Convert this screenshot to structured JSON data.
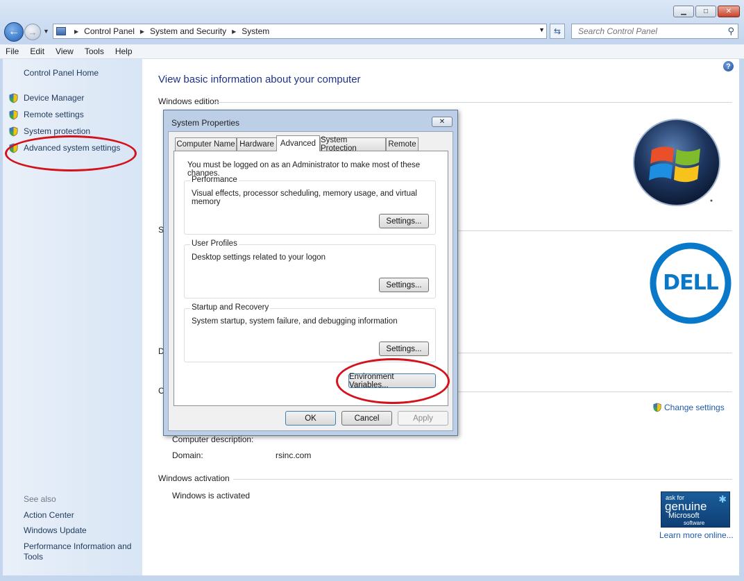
{
  "window": {
    "minimize_glyph": "▁",
    "maximize_glyph": "□",
    "close_glyph": "✕"
  },
  "address": {
    "crumbs": [
      "Control Panel",
      "System and Security",
      "System"
    ],
    "search_placeholder": "Search Control Panel"
  },
  "menu": [
    "File",
    "Edit",
    "View",
    "Tools",
    "Help"
  ],
  "sidebar": {
    "home": "Control Panel Home",
    "items": [
      "Device Manager",
      "Remote settings",
      "System protection",
      "Advanced system settings"
    ],
    "see_also_label": "See also",
    "see_also": [
      "Action Center",
      "Windows Update",
      "Performance Information and Tools"
    ]
  },
  "main": {
    "title": "View basic information about your computer",
    "windows_edition": "Windows edition",
    "partial_s": "S",
    "partial_d": "D",
    "partial_c": "C",
    "computer_description_label": "Computer description:",
    "domain_label": "Domain:",
    "domain_value": "rsinc.com",
    "change_settings": "Change settings",
    "windows_activation": "Windows activation",
    "activated": "Windows is activated",
    "learn_more": "Learn more online...",
    "dell_logo_text": "DELL",
    "genuine": {
      "line1": "ask for",
      "line2": "genuine",
      "line3": "Microsoft",
      "line4": "software"
    }
  },
  "dialog": {
    "title": "System Properties",
    "close_glyph": "✕",
    "tabs": [
      "Computer Name",
      "Hardware",
      "Advanced",
      "System Protection",
      "Remote"
    ],
    "note": "You must be logged on as an Administrator to make most of these changes.",
    "groups": [
      {
        "title": "Performance",
        "desc": "Visual effects, processor scheduling, memory usage, and virtual memory",
        "button": "Settings..."
      },
      {
        "title": "User Profiles",
        "desc": "Desktop settings related to your logon",
        "button": "Settings..."
      },
      {
        "title": "Startup and Recovery",
        "desc": "System startup, system failure, and debugging information",
        "button": "Settings..."
      }
    ],
    "env_button": "Environment Variables...",
    "ok": "OK",
    "cancel": "Cancel",
    "apply": "Apply"
  },
  "colors": {
    "annotation_red": "#d4121b",
    "link_blue": "#1e5aa8",
    "title_blue": "#1e3287"
  }
}
